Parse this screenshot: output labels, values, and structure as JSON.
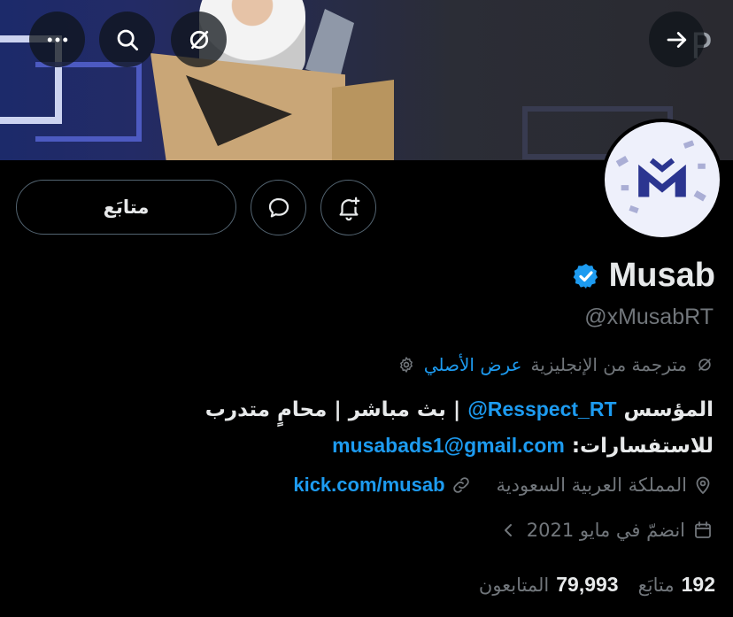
{
  "banner": {
    "overflow_button_icon": "more-horizontal-icon",
    "search_button_icon": "search-icon",
    "translate_button_icon": "translate-off-icon",
    "back_button_icon": "arrow-right-icon"
  },
  "profile": {
    "name": "Musab",
    "verified": true,
    "handle": "@xMusabRT",
    "avatar_logo_text": "M"
  },
  "actions": {
    "follow_label": "متابَع",
    "message_icon": "message-bubble-icon",
    "notify_icon": "bell-plus-icon"
  },
  "translation": {
    "status": "مترجمة من الإنجليزية",
    "show_original": "عرض الأصلي"
  },
  "bio": {
    "part1": "المؤسس ",
    "mention": "@Resspect_RT",
    "part2": " | بث مباشر | محامٍ متدرب",
    "part3": "للاستفسارات: ",
    "email": "musabads1@gmail.com"
  },
  "meta": {
    "location": "المملكة العربية السعودية",
    "website": "kick.com/musab",
    "joined": "انضمّ في مايو 2021"
  },
  "stats": {
    "following_count": "192",
    "following_label": "متابَع",
    "followers_count": "79,993",
    "followers_label": "المتابعون"
  },
  "colors": {
    "background": "#000000",
    "accent": "#1d9bf0",
    "muted": "#71767b",
    "text": "#e7e9ea"
  }
}
